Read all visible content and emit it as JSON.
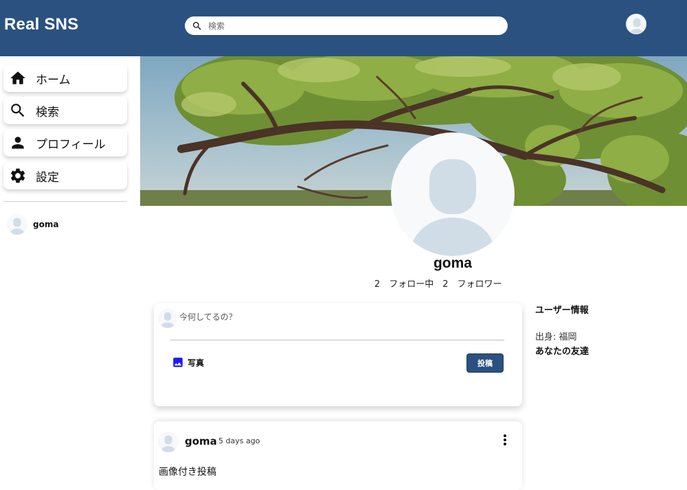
{
  "header": {
    "logo": "Real SNS",
    "search_placeholder": "検索"
  },
  "sidebar": {
    "items": [
      {
        "label": "ホーム",
        "icon": "home-icon"
      },
      {
        "label": "検索",
        "icon": "search-icon"
      },
      {
        "label": "プロフィール",
        "icon": "person-icon"
      },
      {
        "label": "設定",
        "icon": "gear-icon"
      }
    ],
    "friends": [
      {
        "name": "goma"
      }
    ]
  },
  "profile": {
    "name": "goma",
    "stats": "2　フォロー中　2　フォロワー"
  },
  "share": {
    "placeholder": "今何してるの？",
    "photo_label": "写真",
    "post_button": "投稿"
  },
  "post": {
    "username": "goma",
    "date": "5 days ago",
    "text": "画像付き投稿"
  },
  "user_info": {
    "title": "ユーザー情報",
    "hometown": "出身: 福岡",
    "friends_title": "あなたの友達"
  },
  "colors": {
    "header_bg": "#2b5180",
    "accent": "#2b5180",
    "photo_icon": "#1a1aff",
    "avatar_silhouette": "#d1dde6"
  }
}
